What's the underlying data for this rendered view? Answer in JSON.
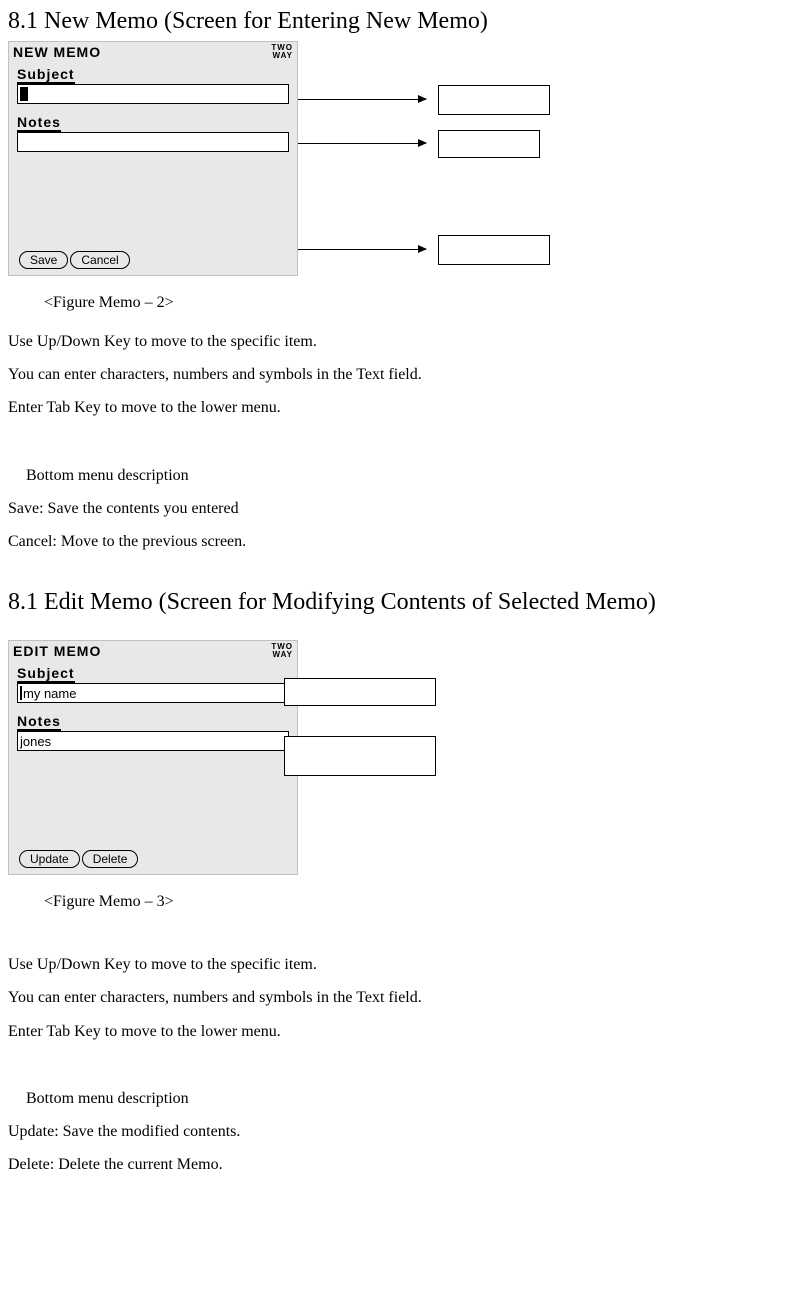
{
  "section1": {
    "heading": "8.1 New Memo (Screen for Entering New Memo)",
    "screen": {
      "title": "NEW MEMO",
      "indicator_top": "TWO",
      "indicator_bottom": "WAY",
      "label_subject": "Subject",
      "label_notes": "Notes",
      "btn_save": "Save",
      "btn_cancel": "Cancel"
    },
    "caption": "<Figure Memo – 2>",
    "body1": "Use Up/Down Key to move to the specific item.",
    "body2": "You can enter characters, numbers and symbols in the Text field.",
    "body3": "Enter Tab Key to move to the lower menu.",
    "bottom_title": "Bottom menu description",
    "bottom1": "Save: Save the contents you entered",
    "bottom2": "Cancel: Move to the previous screen."
  },
  "section2": {
    "heading": "8.1 Edit Memo (Screen for Modifying Contents of Selected Memo)",
    "screen": {
      "title": "EDIT MEMO",
      "indicator_top": "TWO",
      "indicator_bottom": "WAY",
      "label_subject": "Subject",
      "subject_value": "my name",
      "label_notes": "Notes",
      "notes_value": "jones",
      "btn_update": "Update",
      "btn_delete": "Delete"
    },
    "caption": "<Figure Memo – 3>",
    "body1": "Use Up/Down Key to move to the specific item.",
    "body2": "You can enter characters, numbers and symbols in the Text field.",
    "body3": "Enter Tab Key to move to the lower menu.",
    "bottom_title": "Bottom menu description",
    "bottom1": "Update: Save the modified contents.",
    "bottom2": "Delete: Delete the current Memo."
  }
}
